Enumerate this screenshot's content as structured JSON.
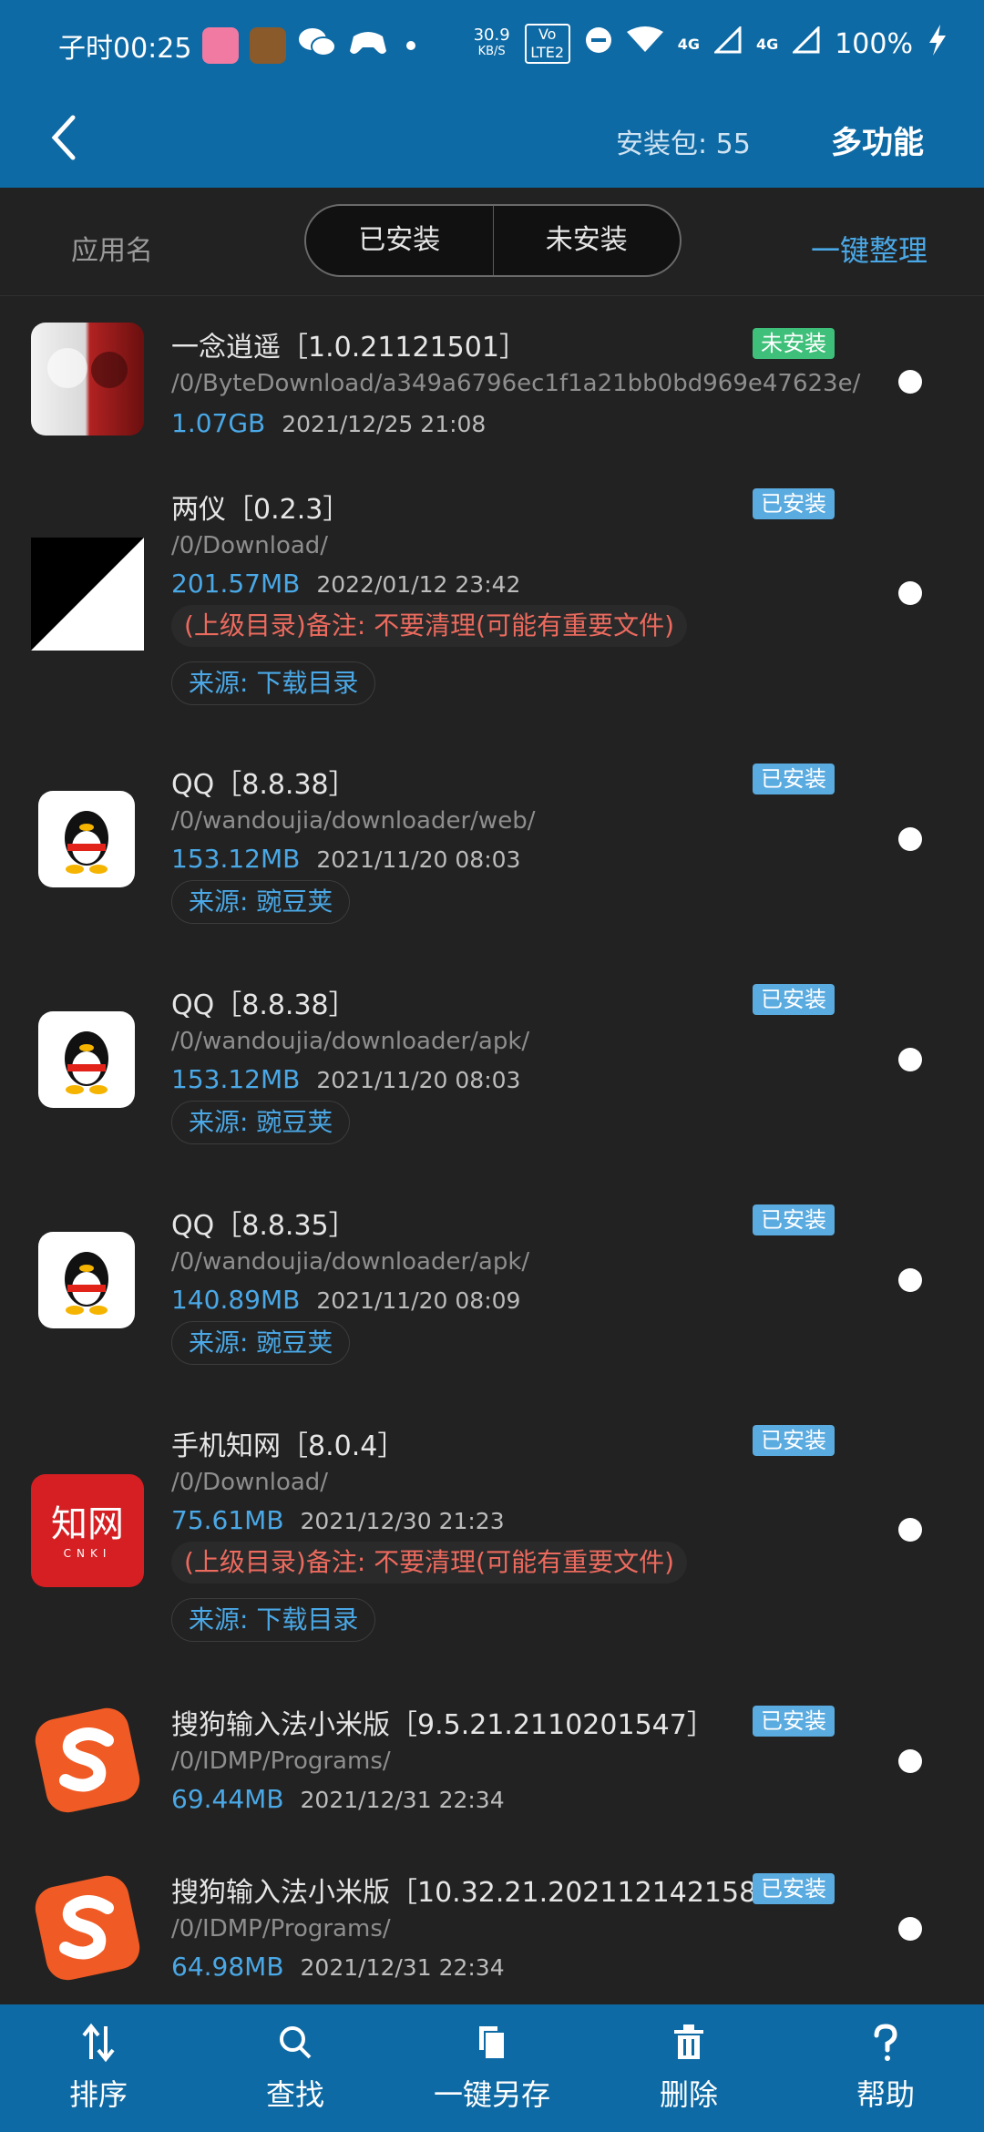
{
  "status_bar": {
    "time": "子时00:25",
    "net_speed": "30.9",
    "net_unit": "KB/S",
    "volte": "Vo LTE2",
    "signal1": "4G",
    "signal2": "4G",
    "battery": "100%"
  },
  "nav": {
    "package_count_label": "安装包: 55",
    "menu_label": "多功能"
  },
  "filter": {
    "app_name_label": "应用名",
    "tabs": [
      "已安装",
      "未安装"
    ],
    "organize_label": "一键整理"
  },
  "colors": {
    "primary": "#0e6aa4",
    "accent": "#4aa8e6",
    "installed_badge": "#5aabe0",
    "uninstalled_badge": "#3fc07a",
    "note_red": "#ec6a5e"
  },
  "apps": [
    {
      "title": "一念逍遥［1.0.21121501］",
      "status": "未安装",
      "path": "/0/ByteDownload/a349a6796ec1f1a21bb0bd969e47623e/",
      "size": "1.07GB",
      "date": "2021/12/25 21:08",
      "icon": "game-art-icon"
    },
    {
      "title": "两仪［0.2.3］",
      "status": "已安装",
      "path": "/0/Download/",
      "size": "201.57MB",
      "date": "2022/01/12 23:42",
      "note": "(上级目录)备注: 不要清理(可能有重要文件)",
      "source": "来源: 下载目录",
      "icon": "liangyi-icon"
    },
    {
      "title": "QQ［8.8.38］",
      "status": "已安装",
      "path": "/0/wandoujia/downloader/web/",
      "size": "153.12MB",
      "date": "2021/11/20 08:03",
      "source": "来源: 豌豆荚",
      "icon": "qq-penguin-icon"
    },
    {
      "title": "QQ［8.8.38］",
      "status": "已安装",
      "path": "/0/wandoujia/downloader/apk/",
      "size": "153.12MB",
      "date": "2021/11/20 08:03",
      "source": "来源: 豌豆荚",
      "icon": "qq-penguin-icon"
    },
    {
      "title": "QQ［8.8.35］",
      "status": "已安装",
      "path": "/0/wandoujia/downloader/apk/",
      "size": "140.89MB",
      "date": "2021/11/20 08:09",
      "source": "来源: 豌豆荚",
      "icon": "qq-penguin-icon"
    },
    {
      "title": "手机知网［8.0.4］",
      "status": "已安装",
      "path": "/0/Download/",
      "size": "75.61MB",
      "date": "2021/12/30 21:23",
      "note": "(上级目录)备注: 不要清理(可能有重要文件)",
      "source": "来源: 下载目录",
      "icon": "cnki-icon",
      "icon_text": "知网",
      "icon_subtext": "CNKI"
    },
    {
      "title": "搜狗输入法小米版［9.5.21.2110201547］",
      "status": "已安装",
      "path": "/0/IDMP/Programs/",
      "size": "69.44MB",
      "date": "2021/12/31 22:34",
      "icon": "sogou-icon"
    },
    {
      "title": "搜狗输入法小米版［10.32.21.202112142158］",
      "status": "已安装",
      "path": "/0/IDMP/Programs/",
      "size": "64.98MB",
      "date": "2021/12/31 22:34",
      "icon": "sogou-icon"
    }
  ],
  "bottom_bar": [
    {
      "label": "排序",
      "icon": "sort-icon"
    },
    {
      "label": "查找",
      "icon": "search-icon"
    },
    {
      "label": "一键另存",
      "icon": "copy-icon"
    },
    {
      "label": "删除",
      "icon": "trash-icon"
    },
    {
      "label": "帮助",
      "icon": "help-icon"
    }
  ]
}
